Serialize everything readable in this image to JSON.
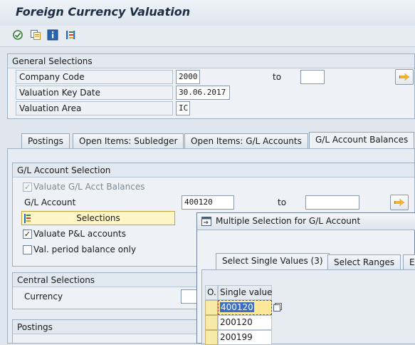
{
  "window": {
    "title": "Foreign Currency Valuation"
  },
  "toolbar": {
    "icons": [
      "execute-icon",
      "copy-variant-icon",
      "info-icon",
      "selection-icon"
    ]
  },
  "general_selections": {
    "header": "General Selections",
    "company_code": {
      "label": "Company Code",
      "value": "2000",
      "to_label": "to",
      "to_value": ""
    },
    "key_date": {
      "label": "Valuation Key Date",
      "value": "30.06.2017"
    },
    "valuation_area": {
      "label": "Valuation Area",
      "value": "IC"
    }
  },
  "tabs": [
    "Postings",
    "Open Items: Subledger",
    "Open Items: G/L Accounts",
    "G/L Account Balances"
  ],
  "active_tab": "G/L Account Balances",
  "gl_selection": {
    "header": "G/L Account Selection",
    "valuate_balances": {
      "label": "Valuate G/L Acct Balances",
      "checked": true,
      "enabled": false
    },
    "gl_account": {
      "label": "G/L Account",
      "value": "400120",
      "to_label": "to",
      "to_value": ""
    },
    "selections_button": "Selections",
    "valuate_pl": {
      "label": "Valuate P&L accounts",
      "checked": true
    },
    "period_balance": {
      "label": "Val. period balance only",
      "checked": false
    }
  },
  "central_selections": {
    "header": "Central Selections",
    "currency_label": "Currency"
  },
  "postings_section": {
    "header": "Postings"
  },
  "popup": {
    "title": "Multiple Selection for G/L Account",
    "tabs": [
      "Select Single Values (3)",
      "Select Ranges",
      "Ex"
    ],
    "columns": [
      "O.",
      "Single value"
    ],
    "values": [
      "400120",
      "200120",
      "200199"
    ]
  },
  "colors": {
    "background": "#dfe6ee",
    "selection_yellow": "#fff6c8",
    "highlight": "#ffe79a",
    "arrow": "#f0b030"
  }
}
